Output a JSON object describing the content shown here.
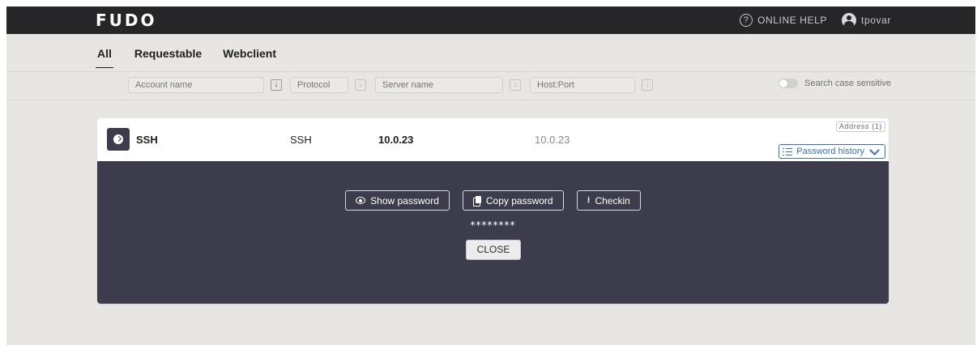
{
  "app": {
    "logo_text": "FUDO",
    "online_help_label": "ONLINE HELP",
    "user_name": "tpovar"
  },
  "tabs": [
    {
      "label": "All",
      "active": true
    },
    {
      "label": "Requestable",
      "active": false
    },
    {
      "label": "Webclient",
      "active": false
    }
  ],
  "filters": {
    "account_placeholder": "Account name",
    "protocol_placeholder": "Protocol",
    "server_placeholder": "Server name",
    "hostport_placeholder": "Host:Port",
    "search_case_label": "Search case sensitive",
    "search_case_enabled": false
  },
  "account_row": {
    "name": "SSH",
    "protocol": "SSH",
    "server": "10.0.23",
    "host_port": "10.0.23",
    "address_badge": "Address (1)",
    "password_history_label": "Password history"
  },
  "password_panel": {
    "show_password_label": "Show password",
    "copy_password_label": "Copy password",
    "checkin_label": "Checkin",
    "masked_password": "********",
    "close_label": "CLOSE"
  },
  "colors": {
    "topbar": "#262528",
    "panel": "#3d3c4d",
    "accent": "#3b6fb3",
    "background": "#e8e6e3"
  }
}
